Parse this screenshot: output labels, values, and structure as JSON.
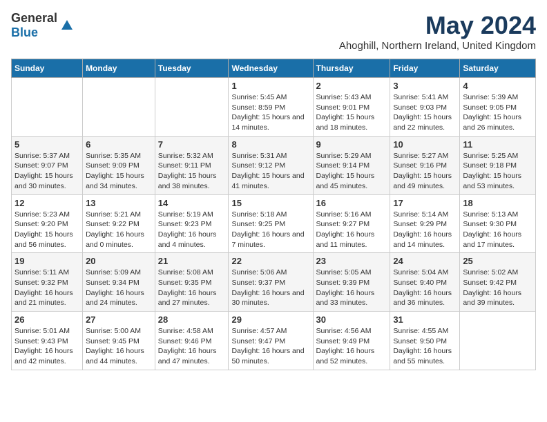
{
  "logo": {
    "general": "General",
    "blue": "Blue"
  },
  "title": "May 2024",
  "subtitle": "Ahoghill, Northern Ireland, United Kingdom",
  "headers": [
    "Sunday",
    "Monday",
    "Tuesday",
    "Wednesday",
    "Thursday",
    "Friday",
    "Saturday"
  ],
  "weeks": [
    [
      {
        "day": "",
        "detail": ""
      },
      {
        "day": "",
        "detail": ""
      },
      {
        "day": "",
        "detail": ""
      },
      {
        "day": "1",
        "detail": "Sunrise: 5:45 AM\nSunset: 8:59 PM\nDaylight: 15 hours and 14 minutes."
      },
      {
        "day": "2",
        "detail": "Sunrise: 5:43 AM\nSunset: 9:01 PM\nDaylight: 15 hours and 18 minutes."
      },
      {
        "day": "3",
        "detail": "Sunrise: 5:41 AM\nSunset: 9:03 PM\nDaylight: 15 hours and 22 minutes."
      },
      {
        "day": "4",
        "detail": "Sunrise: 5:39 AM\nSunset: 9:05 PM\nDaylight: 15 hours and 26 minutes."
      }
    ],
    [
      {
        "day": "5",
        "detail": "Sunrise: 5:37 AM\nSunset: 9:07 PM\nDaylight: 15 hours and 30 minutes."
      },
      {
        "day": "6",
        "detail": "Sunrise: 5:35 AM\nSunset: 9:09 PM\nDaylight: 15 hours and 34 minutes."
      },
      {
        "day": "7",
        "detail": "Sunrise: 5:32 AM\nSunset: 9:11 PM\nDaylight: 15 hours and 38 minutes."
      },
      {
        "day": "8",
        "detail": "Sunrise: 5:31 AM\nSunset: 9:12 PM\nDaylight: 15 hours and 41 minutes."
      },
      {
        "day": "9",
        "detail": "Sunrise: 5:29 AM\nSunset: 9:14 PM\nDaylight: 15 hours and 45 minutes."
      },
      {
        "day": "10",
        "detail": "Sunrise: 5:27 AM\nSunset: 9:16 PM\nDaylight: 15 hours and 49 minutes."
      },
      {
        "day": "11",
        "detail": "Sunrise: 5:25 AM\nSunset: 9:18 PM\nDaylight: 15 hours and 53 minutes."
      }
    ],
    [
      {
        "day": "12",
        "detail": "Sunrise: 5:23 AM\nSunset: 9:20 PM\nDaylight: 15 hours and 56 minutes."
      },
      {
        "day": "13",
        "detail": "Sunrise: 5:21 AM\nSunset: 9:22 PM\nDaylight: 16 hours and 0 minutes."
      },
      {
        "day": "14",
        "detail": "Sunrise: 5:19 AM\nSunset: 9:23 PM\nDaylight: 16 hours and 4 minutes."
      },
      {
        "day": "15",
        "detail": "Sunrise: 5:18 AM\nSunset: 9:25 PM\nDaylight: 16 hours and 7 minutes."
      },
      {
        "day": "16",
        "detail": "Sunrise: 5:16 AM\nSunset: 9:27 PM\nDaylight: 16 hours and 11 minutes."
      },
      {
        "day": "17",
        "detail": "Sunrise: 5:14 AM\nSunset: 9:29 PM\nDaylight: 16 hours and 14 minutes."
      },
      {
        "day": "18",
        "detail": "Sunrise: 5:13 AM\nSunset: 9:30 PM\nDaylight: 16 hours and 17 minutes."
      }
    ],
    [
      {
        "day": "19",
        "detail": "Sunrise: 5:11 AM\nSunset: 9:32 PM\nDaylight: 16 hours and 21 minutes."
      },
      {
        "day": "20",
        "detail": "Sunrise: 5:09 AM\nSunset: 9:34 PM\nDaylight: 16 hours and 24 minutes."
      },
      {
        "day": "21",
        "detail": "Sunrise: 5:08 AM\nSunset: 9:35 PM\nDaylight: 16 hours and 27 minutes."
      },
      {
        "day": "22",
        "detail": "Sunrise: 5:06 AM\nSunset: 9:37 PM\nDaylight: 16 hours and 30 minutes."
      },
      {
        "day": "23",
        "detail": "Sunrise: 5:05 AM\nSunset: 9:39 PM\nDaylight: 16 hours and 33 minutes."
      },
      {
        "day": "24",
        "detail": "Sunrise: 5:04 AM\nSunset: 9:40 PM\nDaylight: 16 hours and 36 minutes."
      },
      {
        "day": "25",
        "detail": "Sunrise: 5:02 AM\nSunset: 9:42 PM\nDaylight: 16 hours and 39 minutes."
      }
    ],
    [
      {
        "day": "26",
        "detail": "Sunrise: 5:01 AM\nSunset: 9:43 PM\nDaylight: 16 hours and 42 minutes."
      },
      {
        "day": "27",
        "detail": "Sunrise: 5:00 AM\nSunset: 9:45 PM\nDaylight: 16 hours and 44 minutes."
      },
      {
        "day": "28",
        "detail": "Sunrise: 4:58 AM\nSunset: 9:46 PM\nDaylight: 16 hours and 47 minutes."
      },
      {
        "day": "29",
        "detail": "Sunrise: 4:57 AM\nSunset: 9:47 PM\nDaylight: 16 hours and 50 minutes."
      },
      {
        "day": "30",
        "detail": "Sunrise: 4:56 AM\nSunset: 9:49 PM\nDaylight: 16 hours and 52 minutes."
      },
      {
        "day": "31",
        "detail": "Sunrise: 4:55 AM\nSunset: 9:50 PM\nDaylight: 16 hours and 55 minutes."
      },
      {
        "day": "",
        "detail": ""
      }
    ]
  ]
}
